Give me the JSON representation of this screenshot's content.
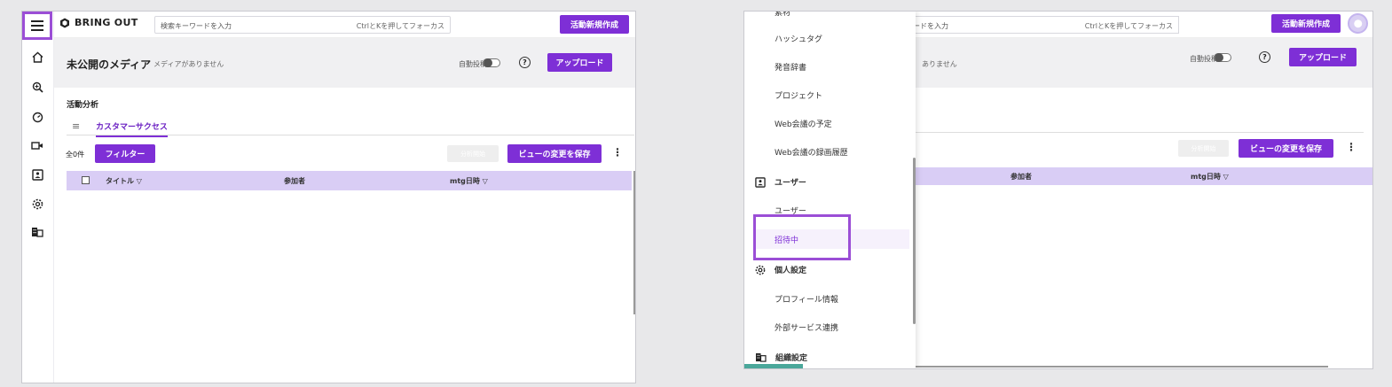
{
  "app": {
    "logo_text": "BRING OUT",
    "search_placeholder": "検索キーワードを入力",
    "search_hint": "CtrlとKを押してフォーカス",
    "search_placeholder_cut": "ワードを入力",
    "new_activity_label": "活動新規作成"
  },
  "media": {
    "title": "未公開のメディア",
    "subtitle": "メディアがありません",
    "subtitle_cut": "ありません",
    "autopost_label": "自動投稿",
    "help_glyph": "?",
    "upload_label": "アップロード"
  },
  "analysis": {
    "section_title": "活動分析",
    "tab_label": "カスタマーサクセス",
    "count_label": "全0件",
    "filter_label": "フィルター",
    "analyze_start_label": "分析開始",
    "save_view_label": "ビューの変更を保存",
    "more_glyph": "⋮",
    "columns": {
      "title": "タイトル ▽",
      "participants": "参加者",
      "mtg_datetime": "mtg日時 ▽"
    }
  },
  "drawer": {
    "top_cut_item": "素材",
    "items_top": [
      "ハッシュタグ",
      "発音辞書",
      "プロジェクト",
      "Web会議の予定",
      "Web会議の録画履歴"
    ],
    "user_section": "ユーザー",
    "user_items": [
      "ユーザー",
      "招待中"
    ],
    "personal_section": "個人設定",
    "personal_items": [
      "プロフィール情報",
      "外部サービス連携"
    ],
    "org_section": "組織設定"
  },
  "colors": {
    "accent": "#7e2fd6",
    "highlight_box": "#9b4ed6",
    "table_header": "#d9cdf5"
  }
}
